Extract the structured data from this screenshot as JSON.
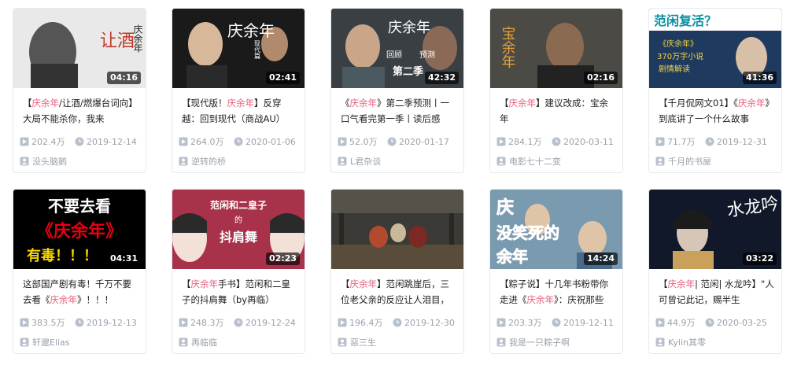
{
  "cards": [
    {
      "duration": "04:16",
      "title_parts": [
        "【",
        "庆余年",
        "/让酒/燃爆台词向】大局不能杀你，我来"
      ],
      "views": "202.4万",
      "date": "2019-12-14",
      "uploader": "没头脑鹅",
      "thumb_text": "让酒",
      "thumb_side": "庆余年"
    },
    {
      "duration": "02:41",
      "title_parts": [
        "【现代版！",
        "庆余年",
        "】反穿越：回到现代（商战AU）"
      ],
      "views": "264.0万",
      "date": "2020-01-06",
      "uploader": "逆转的桥",
      "thumb_text": "庆余年",
      "thumb_side": "现代篇"
    },
    {
      "duration": "42:32",
      "title_parts": [
        "《",
        "庆余年",
        "》第二季预测丨一口气看完第一季丨读后感"
      ],
      "views": "52.0万",
      "date": "2020-01-17",
      "uploader": "L君杂谈",
      "thumb_text": "庆余年",
      "thumb_sub": "回顾",
      "thumb_sub2": "预测",
      "thumb_badge": "第二季"
    },
    {
      "duration": "02:16",
      "title_parts": [
        "【",
        "庆余年",
        "】建议改成：宝余年"
      ],
      "views": "284.1万",
      "date": "2020-03-11",
      "uploader": "电影七十二变",
      "thumb_text": "宝余年"
    },
    {
      "duration": "41:36",
      "title_parts": [
        "【千月侃网文01】《",
        "庆余年",
        "》到底讲了一个什么故事"
      ],
      "views": "71.7万",
      "date": "2019-12-31",
      "uploader": "千月的书屋",
      "thumb_text": "范闲复活？",
      "thumb_l1": "《庆余年》",
      "thumb_l2": "370万字小说",
      "thumb_l3": "剧情解读"
    },
    {
      "duration": "04:31",
      "title_parts": [
        "这部国产剧有毒！千万不要去看《",
        "庆余年",
        "》！！！"
      ],
      "views": "383.5万",
      "date": "2019-12-13",
      "uploader": "轩邈Elias",
      "thumb_text": "不要去看",
      "thumb_mid": "《庆余年》",
      "thumb_bot": "有毒！！！"
    },
    {
      "duration": "02:23",
      "title_parts": [
        "【",
        "庆余年",
        "手书】范闲和二皇子的抖肩舞（by再临）"
      ],
      "views": "248.3万",
      "date": "2019-12-24",
      "uploader": "再临临",
      "thumb_text": "范闲和二皇子",
      "thumb_mid": "的",
      "thumb_bot": "抖肩舞"
    },
    {
      "duration": "",
      "title_parts": [
        "【",
        "庆余年",
        "】范闲跳崖后，三位老父亲的反应让人泪目，"
      ],
      "views": "196.4万",
      "date": "2019-12-30",
      "uploader": "惡三生"
    },
    {
      "duration": "14:24",
      "title_parts": [
        "【粽子说】十几年书粉带你走进《",
        "庆余年",
        "》：庆祝那些"
      ],
      "views": "203.3万",
      "date": "2019-12-11",
      "uploader": "我是一只粽子啊",
      "thumb_text": "庆",
      "thumb_mid": "没笑死的",
      "thumb_bot": "余年"
    },
    {
      "duration": "03:22",
      "title_parts": [
        "【",
        "庆余年",
        "| 范闲| 水龙吟】\"人可曾记此记，赐半生"
      ],
      "views": "44.9万",
      "date": "2020-03-25",
      "uploader": "Kylin其零",
      "thumb_text": "水龙吟"
    }
  ],
  "colors": {
    "highlight": "#e85e7c",
    "meta": "#99a2aa",
    "border": "#e5e9ef"
  }
}
